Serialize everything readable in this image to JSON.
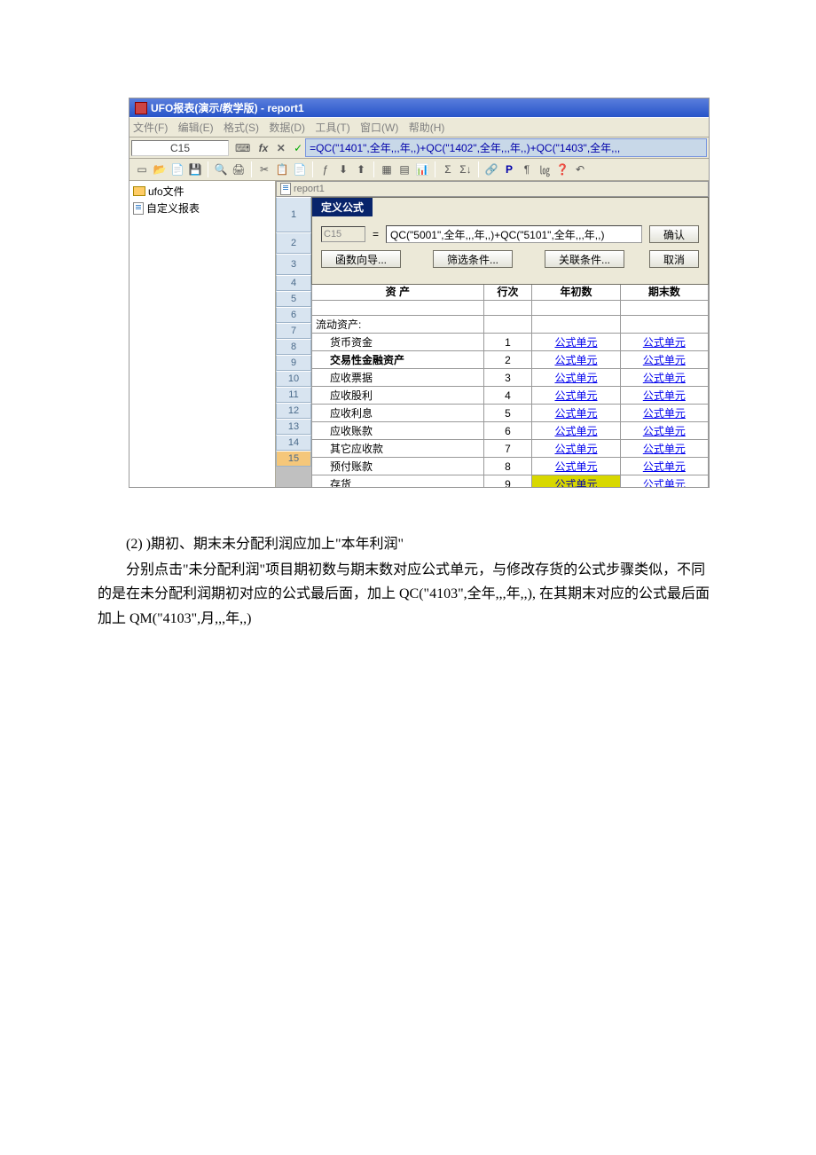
{
  "window": {
    "title": "UFO报表(演示/教学版) - report1",
    "report_tab": "report1"
  },
  "menu": {
    "file": "文件(F)",
    "edit": "编辑(E)",
    "format": "格式(S)",
    "data": "数据(D)",
    "tool": "工具(T)",
    "window": "窗口(W)",
    "help": "帮助(H)"
  },
  "formulabar": {
    "cell_ref": "C15",
    "formula": "=QC(\"1401\",全年,,,年,,)+QC(\"1402\",全年,,,年,,)+QC(\"1403\",全年,,,"
  },
  "toolbar_icons": [
    "new",
    "open",
    "folder",
    "save",
    "preview",
    "print",
    "cut",
    "copy",
    "paste",
    "func",
    "sort",
    "sort2",
    "table",
    "grid",
    "chart",
    "sum",
    "sum2",
    "link",
    "P",
    "flag",
    "log",
    "help",
    "undo"
  ],
  "sidebar": {
    "items": [
      {
        "icon": "folder",
        "label": "ufo文件"
      },
      {
        "icon": "doc",
        "label": "自定义报表"
      }
    ]
  },
  "dialog": {
    "title": "定义公式",
    "cell": "C15",
    "formula": "QC(\"5001\",全年,,,年,,)+QC(\"5101\",全年,,,年,,)",
    "btn_ok": "确认",
    "btn_cancel": "取消",
    "btn_func": "函数向导...",
    "btn_filter": "筛选条件...",
    "btn_assoc": "关联条件..."
  },
  "sheet": {
    "row_numbers": [
      "1",
      "2",
      "3",
      "4",
      "5",
      "6",
      "7",
      "8",
      "9",
      "10",
      "11",
      "12",
      "13",
      "14",
      "15"
    ],
    "headers": {
      "col_a": "资    产",
      "col_b": "行次",
      "col_c": "年初数",
      "col_d": "期末数"
    },
    "section": "流动资产:",
    "rows": [
      {
        "label": "货币资金",
        "line": "1",
        "c": "公式单元",
        "d": "公式单元"
      },
      {
        "label": "交易性金融资产",
        "line": "2",
        "c": "公式单元",
        "d": "公式单元",
        "bold": true
      },
      {
        "label": "应收票据",
        "line": "3",
        "c": "公式单元",
        "d": "公式单元"
      },
      {
        "label": "应收股利",
        "line": "4",
        "c": "公式单元",
        "d": "公式单元"
      },
      {
        "label": "应收利息",
        "line": "5",
        "c": "公式单元",
        "d": "公式单元"
      },
      {
        "label": "应收账款",
        "line": "6",
        "c": "公式单元",
        "d": "公式单元"
      },
      {
        "label": "其它应收款",
        "line": "7",
        "c": "公式单元",
        "d": "公式单元"
      },
      {
        "label": "预付账款",
        "line": "8",
        "c": "公式单元",
        "d": "公式单元"
      },
      {
        "label": "存货",
        "line": "9",
        "c": "公式单元",
        "d": "公式单元",
        "hl_c": true
      }
    ]
  },
  "document": {
    "p1": "(2) )期初、期末未分配利润应加上\"本年利润\"",
    "p2": "分别点击\"未分配利润\"项目期初数与期末数对应公式单元，与修改存货的公式步骤类似，不同的是在未分配利润期初对应的公式最后面，加上 QC(\"4103\",全年,,,年,,), 在其期末对应的公式最后面加上 QM(\"4103\",月,,,年,,)"
  }
}
